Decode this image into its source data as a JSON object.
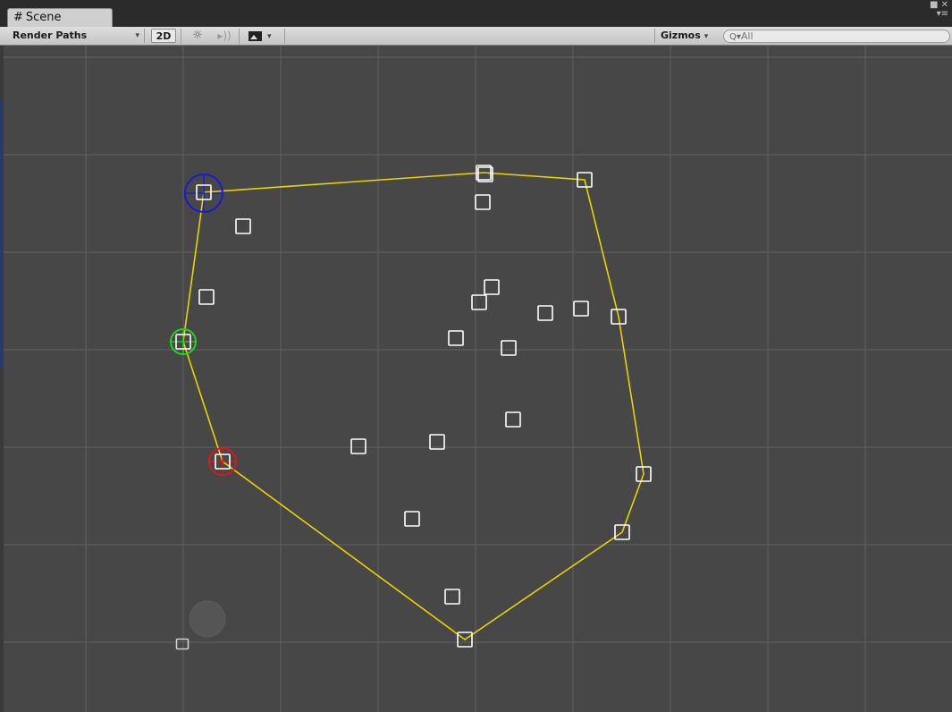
{
  "window": {
    "tab_title": "Scene",
    "tab_icon": "#"
  },
  "toolbar": {
    "shading_mode": "Render Paths",
    "mode_2d": "2D",
    "gizmos": "Gizmos",
    "search_placeholder": "All",
    "icons": {
      "scene_tab": "grid-hash-icon",
      "dropdown": "chevron-down-icon",
      "lighting": "sun-icon",
      "audio": "speaker-icon",
      "effects": "image-icon",
      "search": "search-icon",
      "window": [
        "maximize-icon",
        "close-icon",
        "menu-icon"
      ]
    }
  },
  "scene": {
    "colors": {
      "background": "#474747",
      "grid": "#5e5e5e",
      "path": "#e6d400",
      "node": "#ffffff",
      "start_marker": "#1a1ad6",
      "waypoint_marker": "#22d422",
      "end_marker": "#d41a1a"
    }
  }
}
